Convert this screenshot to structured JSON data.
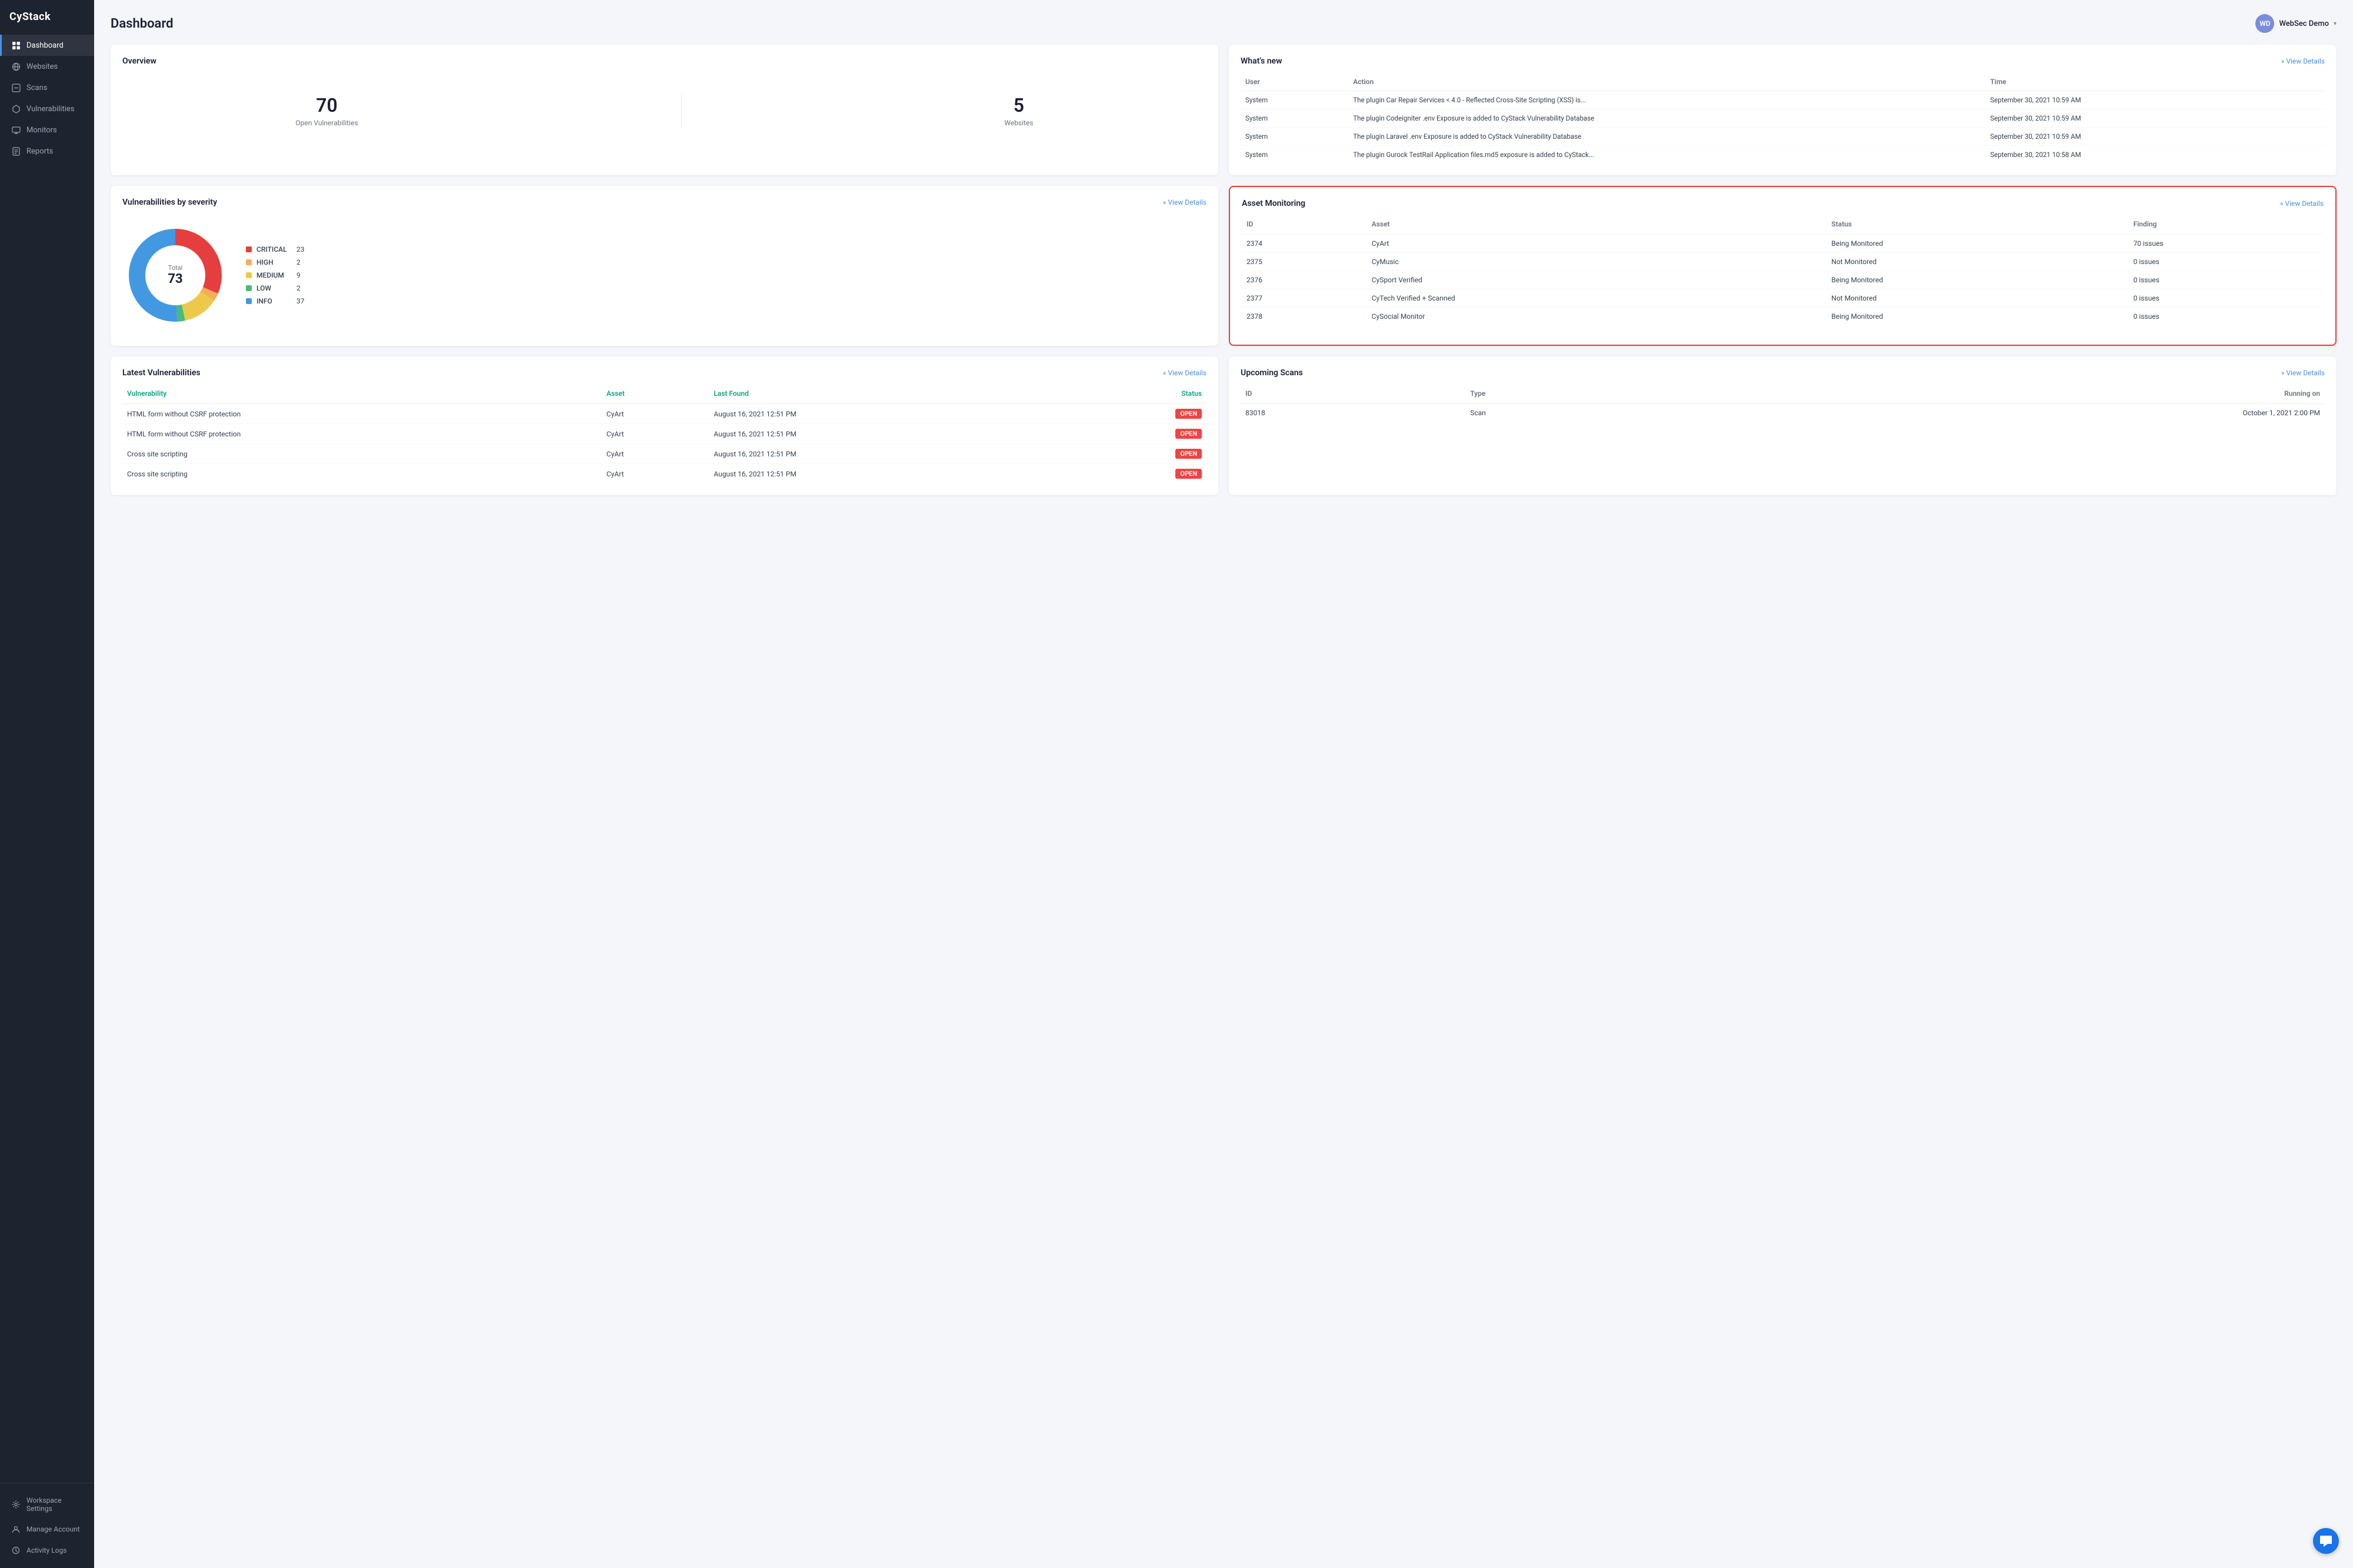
{
  "app": {
    "name": "CyStack"
  },
  "user": {
    "initials": "WD",
    "name": "WebSec Demo",
    "avatar_bg": "#7b8cde"
  },
  "sidebar": {
    "items": [
      {
        "id": "dashboard",
        "label": "Dashboard",
        "icon": "⊞",
        "active": true
      },
      {
        "id": "websites",
        "label": "Websites",
        "icon": "🌐",
        "active": false
      },
      {
        "id": "scans",
        "label": "Scans",
        "icon": "⊡",
        "active": false
      },
      {
        "id": "vulnerabilities",
        "label": "Vulnerabilities",
        "icon": "🛡",
        "active": false
      },
      {
        "id": "monitors",
        "label": "Monitors",
        "icon": "📡",
        "active": false
      },
      {
        "id": "reports",
        "label": "Reports",
        "icon": "📋",
        "active": false
      }
    ],
    "bottom_items": [
      {
        "id": "workspace-settings",
        "label": "Workspace Settings",
        "icon": "⚙"
      },
      {
        "id": "manage-account",
        "label": "Manage Account",
        "icon": "👤"
      },
      {
        "id": "activity-logs",
        "label": "Activity Logs",
        "icon": "🕐"
      }
    ]
  },
  "page": {
    "title": "Dashboard"
  },
  "overview": {
    "title": "Overview",
    "open_vulnerabilities": 70,
    "open_vulnerabilities_label": "Open Vulnerabilities",
    "websites": 5,
    "websites_label": "Websites"
  },
  "whats_new": {
    "title": "What's new",
    "view_details": "» View Details",
    "columns": [
      "User",
      "Action",
      "Time"
    ],
    "rows": [
      {
        "user": "System",
        "action": "The plugin Car Repair Services < 4.0 - Reflected Cross-Site Scripting (XSS) is...",
        "time": "September 30, 2021 10:59 AM"
      },
      {
        "user": "System",
        "action": "The plugin Codeigniter .env Exposure is added to CyStack Vulnerability Database",
        "time": "September 30, 2021 10:59 AM"
      },
      {
        "user": "System",
        "action": "The plugin Laravel .env Exposure is added to CyStack Vulnerability Database",
        "time": "September 30, 2021 10:59 AM"
      },
      {
        "user": "System",
        "action": "The plugin Gurock TestRail Application files.md5 exposure is added to CyStack...",
        "time": "September 30, 2021 10:58 AM"
      }
    ]
  },
  "vulnerabilities_by_severity": {
    "title": "Vulnerabilities by severity",
    "view_details": "» View Details",
    "total": 73,
    "total_label": "Total",
    "legend": [
      {
        "name": "CRITICAL",
        "value": 23,
        "color": "#e53e3e"
      },
      {
        "name": "HIGH",
        "value": 2,
        "color": "#f6ad55"
      },
      {
        "name": "MEDIUM",
        "value": 9,
        "color": "#ecc94b"
      },
      {
        "name": "LOW",
        "value": 2,
        "color": "#48bb78"
      },
      {
        "name": "INFO",
        "value": 37,
        "color": "#4299e1"
      }
    ]
  },
  "asset_monitoring": {
    "title": "Asset Monitoring",
    "view_details": "» View Details",
    "columns": [
      "ID",
      "Asset",
      "Status",
      "Finding"
    ],
    "rows": [
      {
        "id": "2374",
        "asset": "CyArt",
        "status": "Being Monitored",
        "finding": "70 issues"
      },
      {
        "id": "2375",
        "asset": "CyMusic",
        "status": "Not Monitored",
        "finding": "0 issues"
      },
      {
        "id": "2376",
        "asset": "CySport Verified",
        "status": "Being Monitored",
        "finding": "0 issues"
      },
      {
        "id": "2377",
        "asset": "CyTech Verified + Scanned",
        "status": "Not Monitored",
        "finding": "0 issues"
      },
      {
        "id": "2378",
        "asset": "CySocial Monitor",
        "status": "Being Monitored",
        "finding": "0 issues"
      }
    ]
  },
  "latest_vulnerabilities": {
    "title": "Latest Vulnerabilities",
    "view_details": "» View Details",
    "columns": [
      "Vulnerability",
      "Asset",
      "Last Found",
      "Status"
    ],
    "rows": [
      {
        "vuln": "HTML form without CSRF protection",
        "asset": "CyArt",
        "last_found": "August 16, 2021 12:51 PM",
        "status": "OPEN"
      },
      {
        "vuln": "HTML form without CSRF protection",
        "asset": "CyArt",
        "last_found": "August 16, 2021 12:51 PM",
        "status": "OPEN"
      },
      {
        "vuln": "Cross site scripting",
        "asset": "CyArt",
        "last_found": "August 16, 2021 12:51 PM",
        "status": "OPEN"
      },
      {
        "vuln": "Cross site scripting",
        "asset": "CyArt",
        "last_found": "August 16, 2021 12:51 PM",
        "status": "OPEN"
      }
    ]
  },
  "upcoming_scans": {
    "title": "Upcoming Scans",
    "view_details": "» View Details",
    "columns": [
      "ID",
      "Type",
      "Running on"
    ],
    "rows": [
      {
        "id": "83018",
        "type": "Scan",
        "running_on": "October 1, 2021 2:00 PM"
      }
    ]
  }
}
